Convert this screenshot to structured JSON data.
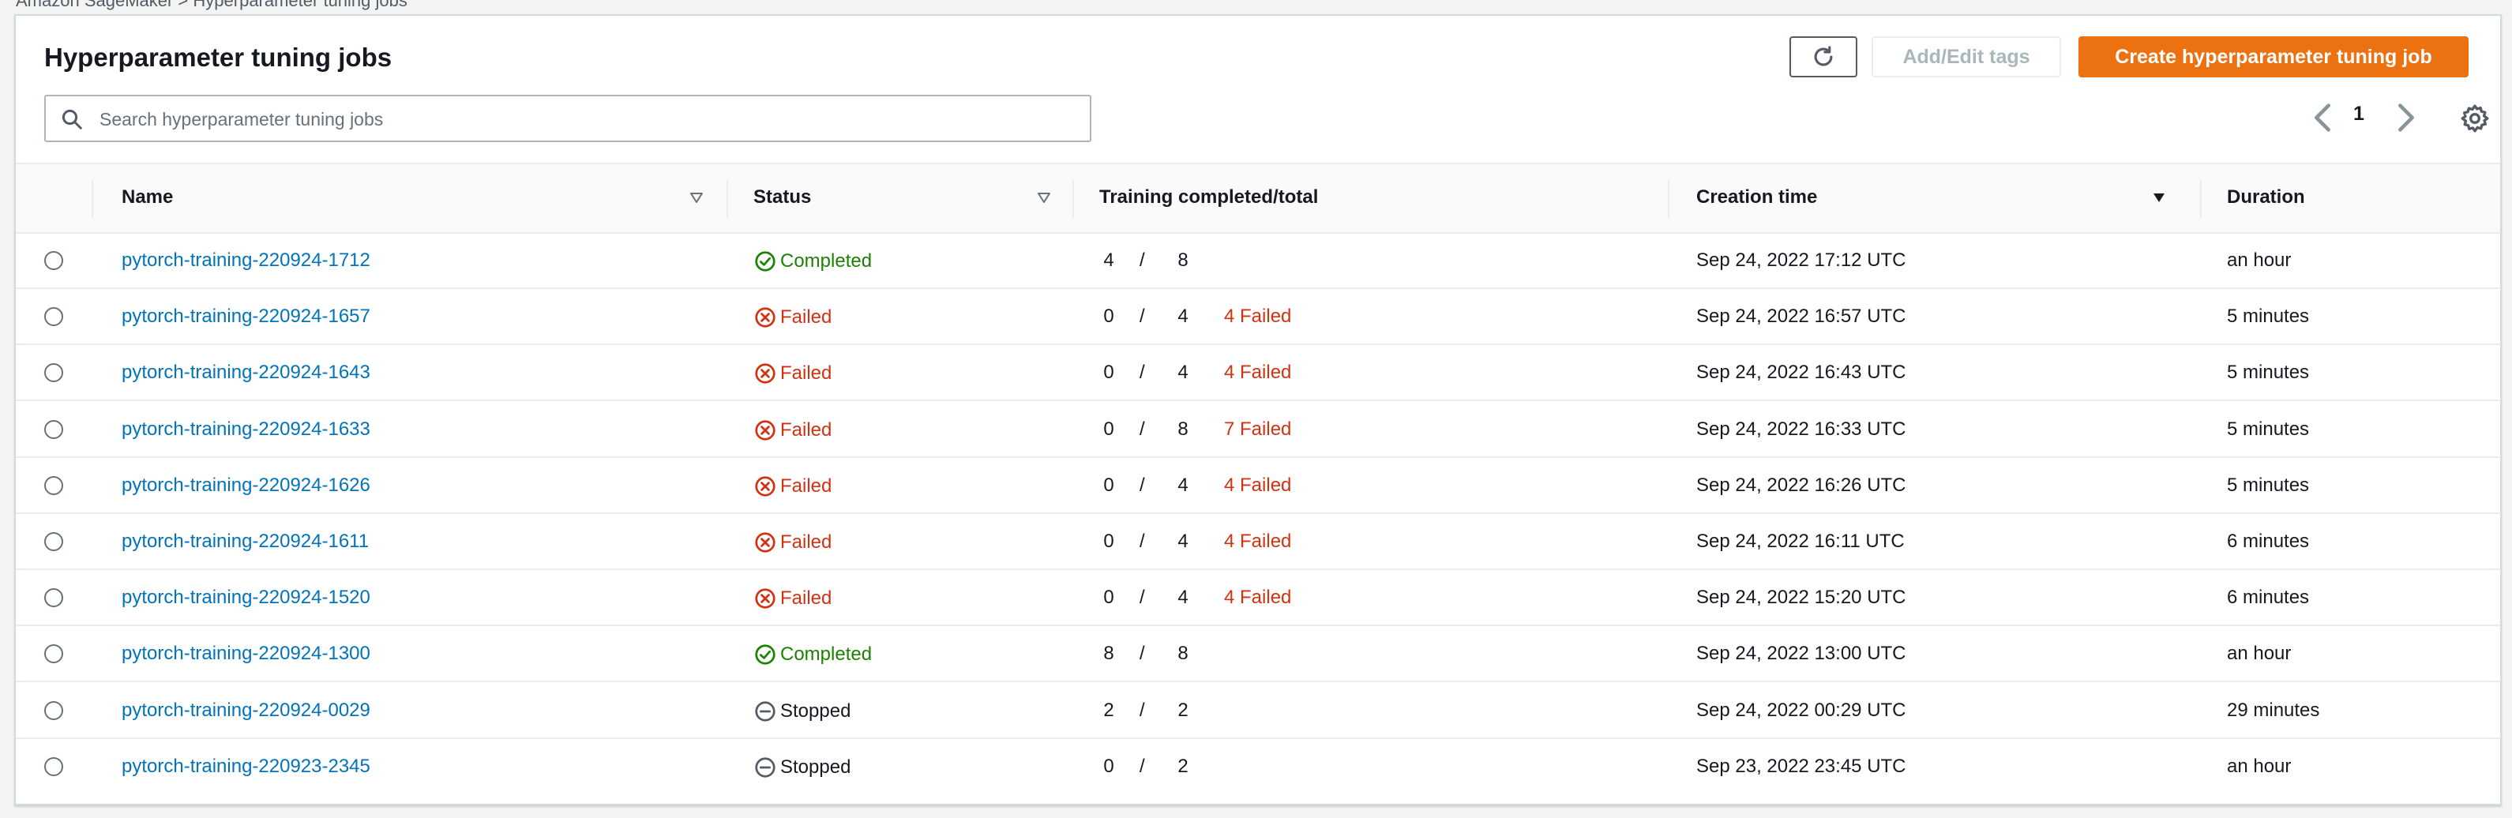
{
  "breadcrumb": "Amazon SageMaker  >  Hyperparameter tuning jobs",
  "header": {
    "title": "Hyperparameter tuning jobs",
    "add_edit_tags_label": "Add/Edit tags",
    "create_label": "Create hyperparameter tuning job"
  },
  "search": {
    "placeholder": "Search hyperparameter tuning jobs",
    "value": ""
  },
  "pagination": {
    "current_page": "1"
  },
  "columns": {
    "name": "Name",
    "status": "Status",
    "training": "Training completed/total",
    "creation_time": "Creation time",
    "duration": "Duration"
  },
  "sort": {
    "column": "Creation time",
    "direction": "descending"
  },
  "colors": {
    "accent": "#ec7211",
    "link": "#0073bb",
    "success": "#1d8102",
    "error": "#d13212"
  },
  "icons": {
    "refresh": "refresh-icon",
    "search": "search-icon",
    "prev": "chevron-left-icon",
    "next": "chevron-right-icon",
    "settings": "gear-icon",
    "completed": "check-circle-icon",
    "failed": "x-circle-icon",
    "stopped": "minus-circle-icon"
  },
  "rows": [
    {
      "name": "pytorch-training-220924-1712",
      "status": "Completed",
      "completed": "4",
      "total": "8",
      "failed": "",
      "creation_time": "Sep 24, 2022 17:12 UTC",
      "duration": "an hour"
    },
    {
      "name": "pytorch-training-220924-1657",
      "status": "Failed",
      "completed": "0",
      "total": "4",
      "failed": "4 Failed",
      "creation_time": "Sep 24, 2022 16:57 UTC",
      "duration": "5 minutes"
    },
    {
      "name": "pytorch-training-220924-1643",
      "status": "Failed",
      "completed": "0",
      "total": "4",
      "failed": "4 Failed",
      "creation_time": "Sep 24, 2022 16:43 UTC",
      "duration": "5 minutes"
    },
    {
      "name": "pytorch-training-220924-1633",
      "status": "Failed",
      "completed": "0",
      "total": "8",
      "failed": "7 Failed",
      "creation_time": "Sep 24, 2022 16:33 UTC",
      "duration": "5 minutes"
    },
    {
      "name": "pytorch-training-220924-1626",
      "status": "Failed",
      "completed": "0",
      "total": "4",
      "failed": "4 Failed",
      "creation_time": "Sep 24, 2022 16:26 UTC",
      "duration": "5 minutes"
    },
    {
      "name": "pytorch-training-220924-1611",
      "status": "Failed",
      "completed": "0",
      "total": "4",
      "failed": "4 Failed",
      "creation_time": "Sep 24, 2022 16:11 UTC",
      "duration": "6 minutes"
    },
    {
      "name": "pytorch-training-220924-1520",
      "status": "Failed",
      "completed": "0",
      "total": "4",
      "failed": "4 Failed",
      "creation_time": "Sep 24, 2022 15:20 UTC",
      "duration": "6 minutes"
    },
    {
      "name": "pytorch-training-220924-1300",
      "status": "Completed",
      "completed": "8",
      "total": "8",
      "failed": "",
      "creation_time": "Sep 24, 2022 13:00 UTC",
      "duration": "an hour"
    },
    {
      "name": "pytorch-training-220924-0029",
      "status": "Stopped",
      "completed": "2",
      "total": "2",
      "failed": "",
      "creation_time": "Sep 24, 2022 00:29 UTC",
      "duration": "29 minutes"
    },
    {
      "name": "pytorch-training-220923-2345",
      "status": "Stopped",
      "completed": "0",
      "total": "2",
      "failed": "",
      "creation_time": "Sep 23, 2022 23:45 UTC",
      "duration": "an hour"
    }
  ]
}
